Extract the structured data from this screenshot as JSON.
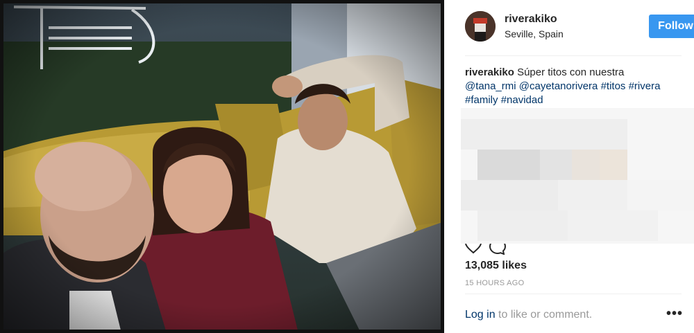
{
  "post": {
    "photo_description_icon": "photo-icon"
  },
  "header": {
    "username": "riverakiko",
    "location": "Seville, Spain",
    "follow_label": "Follow"
  },
  "caption": {
    "username": "riverakiko",
    "text": "Súper titos con nuestra",
    "mentions": [
      "@tana_rmi",
      "@cayetanorivera"
    ],
    "hashtags": [
      "#titos",
      "#rivera",
      "#family",
      "#navidad"
    ]
  },
  "stats": {
    "likes": "13,085 likes",
    "time_ago": "15 HOURS AGO"
  },
  "footer": {
    "login_link": "Log in",
    "login_rest": "to like or comment."
  },
  "colors": {
    "follow_button": "#3897f0",
    "link": "#003569",
    "muted": "#999999"
  }
}
